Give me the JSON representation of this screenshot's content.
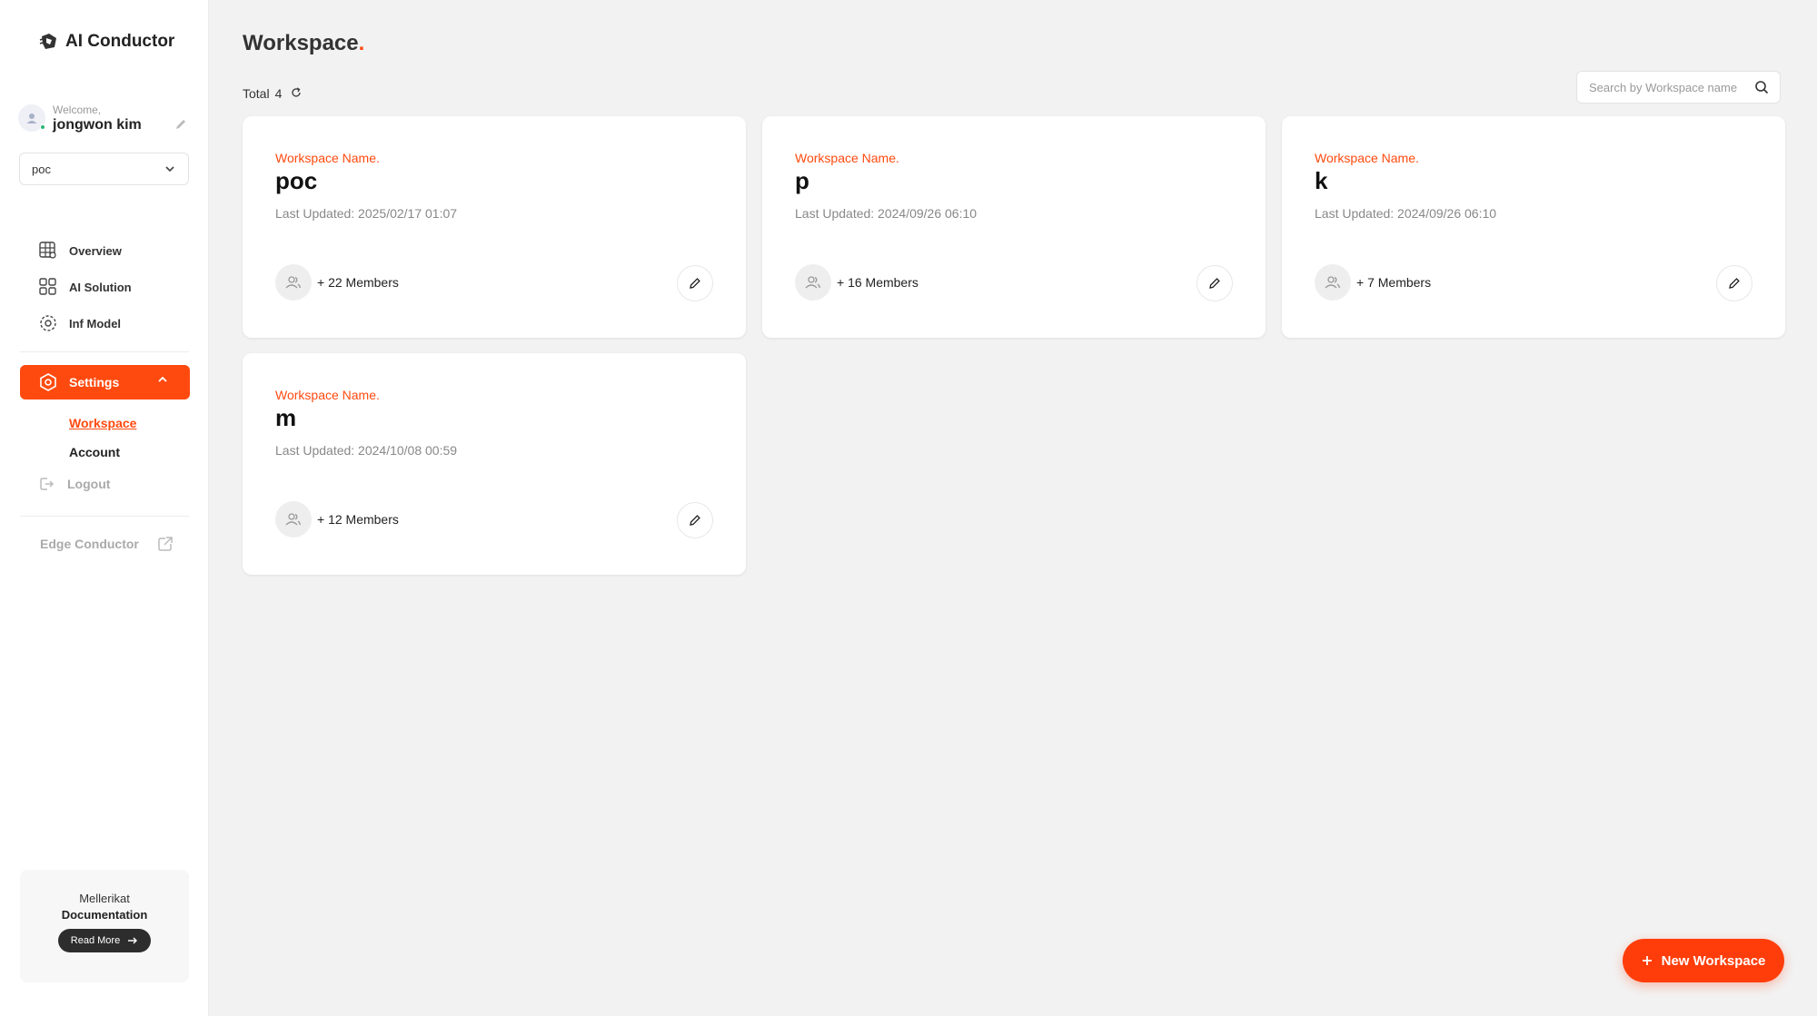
{
  "app": {
    "title": "AI Conductor"
  },
  "user": {
    "welcome": "Welcome,",
    "name": "jongwon kim"
  },
  "workspace_select": {
    "value": "poc"
  },
  "nav": {
    "items": [
      {
        "label": "Overview",
        "icon": "grid-globe-icon"
      },
      {
        "label": "AI Solution",
        "icon": "grid-icon"
      },
      {
        "label": "Inf Model",
        "icon": "model-icon"
      }
    ],
    "settings": {
      "label": "Settings"
    },
    "sub_items": [
      {
        "label": "Workspace",
        "active": true
      },
      {
        "label": "Account",
        "active": false
      }
    ],
    "logout": "Logout",
    "edge": "Edge Conductor"
  },
  "docs": {
    "line1": "Mellerikat",
    "line2": "Documentation",
    "button": "Read More"
  },
  "page": {
    "title": "Workspace",
    "title_dot": ".",
    "total_label": "Total",
    "total_count": "4",
    "search_placeholder": "Search by Workspace name"
  },
  "cards": [
    {
      "label": "Workspace Name.",
      "name": "poc",
      "updated": "Last Updated: 2025/02/17 01:07",
      "members": "+ 22 Members"
    },
    {
      "label": "Workspace Name.",
      "name": "p",
      "updated": "Last Updated: 2024/09/26 06:10",
      "members": "+ 16 Members"
    },
    {
      "label": "Workspace Name.",
      "name": "k",
      "updated": "Last Updated: 2024/09/26 06:10",
      "members": "+ 7 Members"
    },
    {
      "label": "Workspace Name.",
      "name": "m",
      "updated": "Last Updated: 2024/10/08 00:59",
      "members": "+ 12 Members"
    }
  ],
  "new_button": {
    "label": "New Workspace"
  },
  "colors": {
    "accent": "#ff4a0f",
    "background": "#f2f2f2"
  }
}
